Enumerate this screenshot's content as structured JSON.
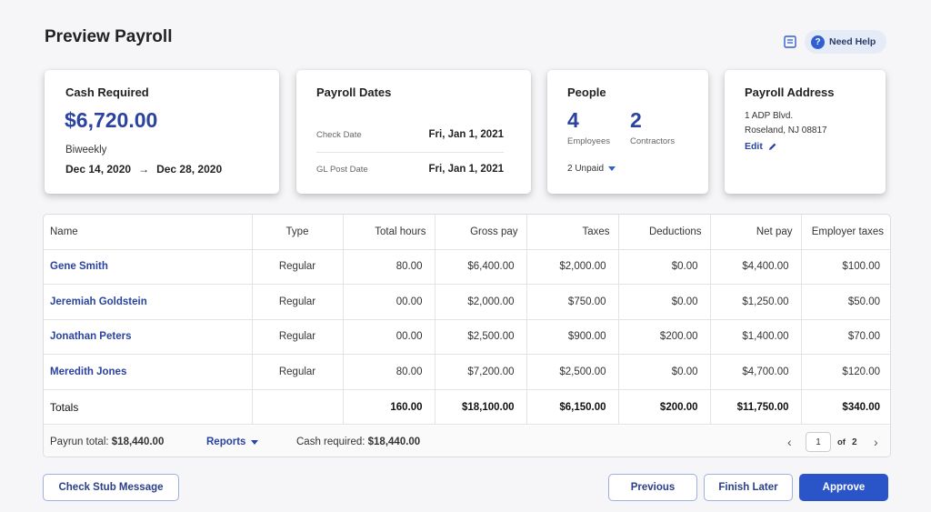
{
  "header": {
    "title": "Preview Payroll",
    "help_label": "Need Help",
    "doc_icon": "document-icon",
    "help_icon": "question-circle-icon"
  },
  "cards": {
    "cash": {
      "title": "Cash Required",
      "amount": "$6,720.00",
      "frequency": "Biweekly",
      "start": "Dec 14, 2020",
      "arrow": "→",
      "end": "Dec 28, 2020"
    },
    "dates": {
      "title": "Payroll Dates",
      "check_label": "Check Date",
      "check_value": "Fri, Jan 1, 2021",
      "gl_label": "GL Post Date",
      "gl_value": "Fri, Jan 1, 2021"
    },
    "people": {
      "title": "People",
      "employees_count": "4",
      "employees_label": "Employees",
      "contractors_count": "2",
      "contractors_label": "Contractors",
      "unpaid_label": "2 Unpaid"
    },
    "address": {
      "title": "Payroll Address",
      "line1": "1 ADP Blvd.",
      "line2": "Roseland, NJ 08817",
      "edit_label": "Edit"
    }
  },
  "table": {
    "headers": [
      "Name",
      "Type",
      "Total hours",
      "Gross pay",
      "Taxes",
      "Deductions",
      "Net pay",
      "Employer taxes"
    ],
    "rows": [
      [
        "Gene Smith",
        "Regular",
        "80.00",
        "$6,400.00",
        "$2,000.00",
        "$0.00",
        "$4,400.00",
        "$100.00"
      ],
      [
        "Jeremiah Goldstein",
        "Regular",
        "00.00",
        "$2,000.00",
        "$750.00",
        "$0.00",
        "$1,250.00",
        "$50.00"
      ],
      [
        "Jonathan Peters",
        "Regular",
        "00.00",
        "$2,500.00",
        "$900.00",
        "$200.00",
        "$1,400.00",
        "$70.00"
      ],
      [
        "Meredith Jones",
        "Regular",
        "80.00",
        "$7,200.00",
        "$2,500.00",
        "$0.00",
        "$4,700.00",
        "$120.00"
      ]
    ],
    "totals": [
      "Totals",
      "",
      "160.00",
      "$18,100.00",
      "$6,150.00",
      "$200.00",
      "$11,750.00",
      "$340.00"
    ]
  },
  "footer": {
    "payrun_label": "Payrun total:",
    "payrun_value": "$18,440.00",
    "reports_label": "Reports",
    "cash_label": "Cash required:",
    "cash_value": "$18,440.00",
    "page_current": "1",
    "page_of": "of",
    "page_total": "2"
  },
  "actions": {
    "stub_message": "Check Stub Message",
    "previous": "Previous",
    "finish_later": "Finish Later",
    "approve": "Approve"
  },
  "colors": {
    "accent": "#2a43a0",
    "primary_button": "#2a55c9",
    "help_bg": "#e6ecf7"
  }
}
